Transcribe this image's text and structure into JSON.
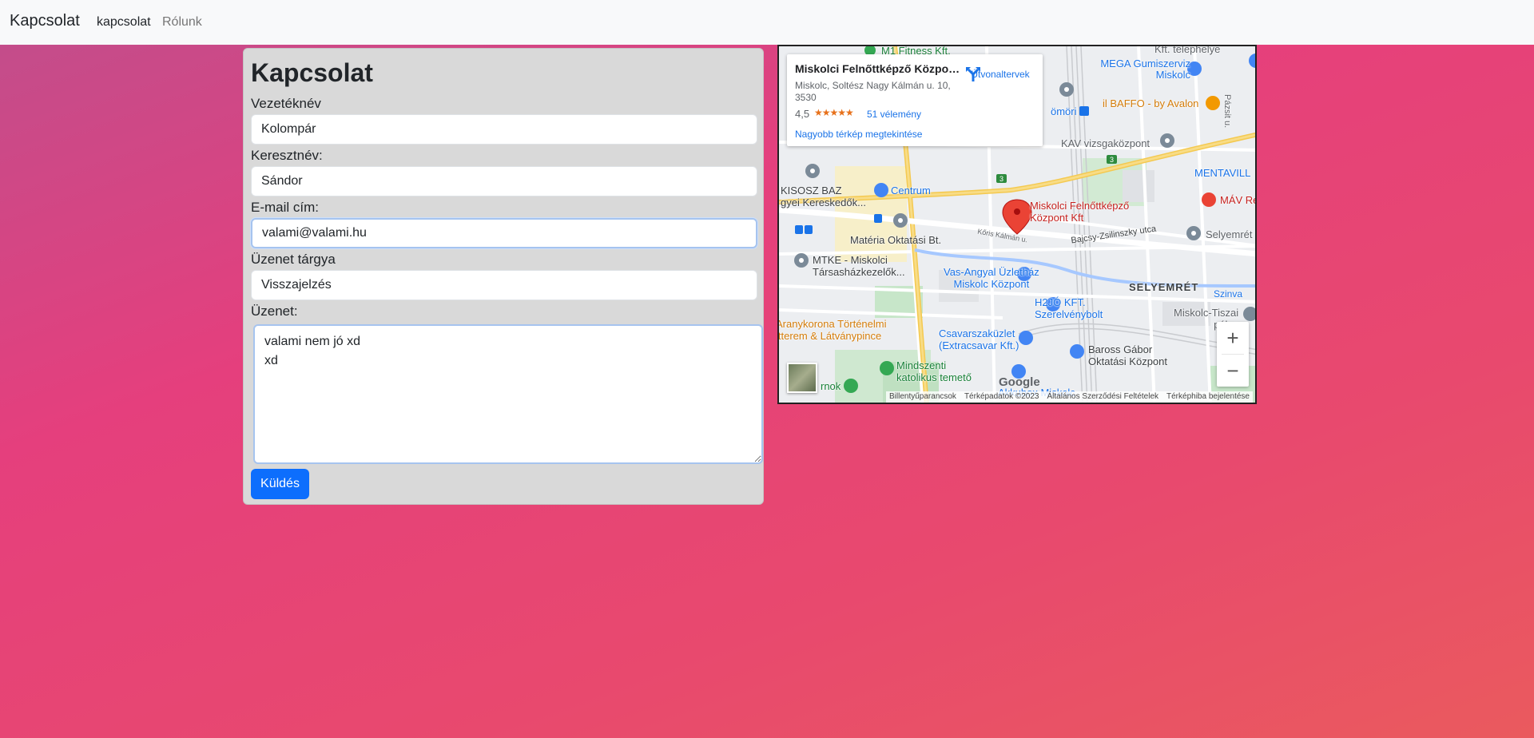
{
  "navbar": {
    "brand": "Kapcsolat",
    "links": [
      {
        "label": "kapcsolat",
        "active": true
      },
      {
        "label": "Rólunk",
        "active": false
      }
    ]
  },
  "form": {
    "title": "Kapcsolat",
    "last_name": {
      "label": "Vezetéknév",
      "value": "Kolompár"
    },
    "first_name": {
      "label": "Keresztnév:",
      "value": "Sándor"
    },
    "email": {
      "label": "E-mail cím:",
      "value": "valami@valami.hu"
    },
    "subject": {
      "label": "Üzenet tárgya",
      "value": "Visszajelzés"
    },
    "message": {
      "label": "Üzenet:",
      "value": "valami nem jó xd\nxd"
    },
    "submit_label": "Küldés",
    "accent_color": "#0d6efd"
  },
  "map": {
    "info_card": {
      "title": "Miskolci Felnőttképző Közpon...",
      "address": "Miskolc, Soltész Nagy Kálmán u. 10, 3530",
      "rating": "4,5",
      "stars": "★★★★★",
      "reviews": "51 vélemény",
      "larger_map": "Nagyobb térkép megtekintése",
      "directions": "Útvonaltervek"
    },
    "labels": {
      "fitness": "M1 Fitness Kft.",
      "telephely": "Kft. telephelye",
      "mega": "MEGA Gumiszerviz Miskolc",
      "baffo": "il BAFFO - by Avalon",
      "pazsit": "Pázsit u.",
      "bomori": "ömöri",
      "kav": "KAV vizsgaközpont",
      "mentavill": "MENTAVILL",
      "mav": "MÁV Re",
      "kisosz": "KISOSZ BAZ\ngyei Kereskedők...",
      "centrum": "Centrum",
      "pin": "Miskolci Felnőttképző\nKözpont Kft",
      "materia": "Matéria Oktatási Bt.",
      "bajcsy": "Bajcsy-Zsilinszky utca",
      "selyemret_place": "Selyemrét",
      "koris": "Kőris Kálmán u.",
      "mtke": "MTKE - Miskolci\nTársasházkezelők...",
      "vasangyal": "Vas-Angyal Üzletház\nMiskolc Központ",
      "selyemret": "SELYEMRÉT",
      "szinva": "Szinva",
      "h2jo": "H2JÓ KFT.\nSzerelvénybolt",
      "tiszai": "Miskolc-Tiszai\npálya",
      "aranykorona": "Aranykorona Történelmi\nitterem & Látványpince",
      "csavar": "Csavarszaküzlet\n(Extracsavar Kft.)",
      "baross": "Baross Gábor\nOktatási Központ",
      "mindszenti": "Mindszenti\nkatolikus temető",
      "akkubox": "Akkubox Miskolc",
      "rnok": "rnok"
    },
    "google": "Google",
    "attribution": [
      "Billentyűparancsok",
      "Térképadatok ©2023",
      "Általános Szerződési Feltételek",
      "Térképhiba bejelentése"
    ],
    "zoom_in": "+",
    "zoom_out": "−"
  }
}
